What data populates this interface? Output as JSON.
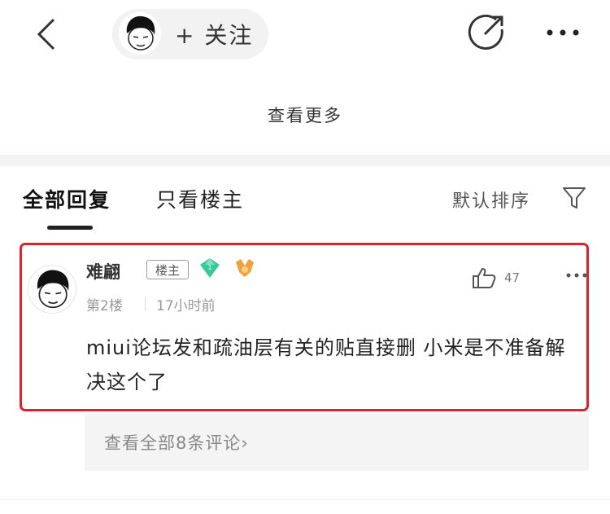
{
  "header": {
    "follow_label": "+ 关注",
    "icons": {
      "back": "chevron-left-icon",
      "share": "share-icon",
      "more": "more-dots-icon"
    }
  },
  "view_more": "查看更多",
  "tabs": [
    {
      "label": "全部回复",
      "active": true
    },
    {
      "label": "只看楼主",
      "active": false
    }
  ],
  "sort": {
    "label": "默认排序",
    "icon": "filter-icon"
  },
  "comment": {
    "username": "难翩",
    "badge": "楼主",
    "floor": "第2楼",
    "time": "17小时前",
    "likes": "47",
    "text": "miui论坛发和疏油层有关的贴直接删 小米是不准备解决这个了",
    "replies_link": "查看全部8条评论›"
  },
  "colors": {
    "highlight": "#e0202a",
    "gem": "#36c99a",
    "medal": "#f2a03a"
  }
}
